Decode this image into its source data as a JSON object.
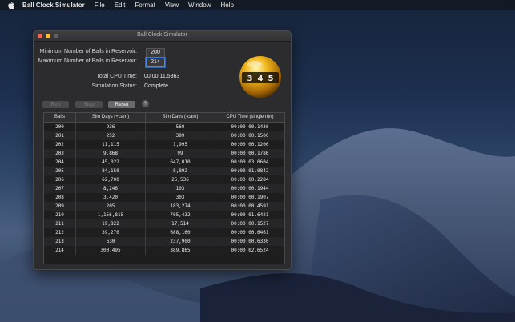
{
  "menubar": {
    "app_name": "Ball Clock Simulator",
    "items": [
      "File",
      "Edit",
      "Format",
      "View",
      "Window",
      "Help"
    ]
  },
  "window": {
    "title": "Ball Clock Simulator"
  },
  "settings": {
    "min_label": "Minimum Number of Balls in Reservoir:",
    "min_value": "200",
    "max_label": "Maximum Number of Balls in Reservoir:",
    "max_value": "214",
    "cpu_label": "Total CPU Time:",
    "cpu_value": "00:00:11.5363",
    "status_label": "Simulation Status:",
    "status_value": "Complete"
  },
  "buttons": {
    "run": "Run",
    "stop": "Stop",
    "reset": "Reset",
    "help": "?"
  },
  "logo": {
    "digits": [
      "3",
      "4",
      "5"
    ]
  },
  "table": {
    "columns": [
      "Balls",
      "Sim Days (+cam)",
      "Sim Days (-cam)",
      "CPU Time (single run)"
    ],
    "rows": [
      [
        "200",
        "936",
        "560",
        "00:00:00.1436"
      ],
      [
        "201",
        "252",
        "399",
        "00:00:00.1500"
      ],
      [
        "202",
        "11,115",
        "1,995",
        "00:00:00.1206"
      ],
      [
        "203",
        "9,868",
        "99",
        "00:00:00.1786"
      ],
      [
        "204",
        "45,022",
        "647,010",
        "00:00:03.0604"
      ],
      [
        "205",
        "84,150",
        "8,892",
        "00:00:01.0842"
      ],
      [
        "206",
        "62,700",
        "25,536",
        "00:00:00.2284"
      ],
      [
        "207",
        "8,246",
        "103",
        "00:00:00.1944"
      ],
      [
        "208",
        "3,420",
        "303",
        "00:00:00.1907"
      ],
      [
        "209",
        "205",
        "183,274",
        "00:00:00.4591"
      ],
      [
        "210",
        "1,156,815",
        "705,432",
        "00:00:01.6421"
      ],
      [
        "211",
        "19,822",
        "17,514",
        "00:00:00.1527"
      ],
      [
        "212",
        "39,270",
        "688,160",
        "00:00:00.6461"
      ],
      [
        "213",
        "630",
        "237,900",
        "00:00:00.6330"
      ],
      [
        "214",
        "300,495",
        "389,865",
        "00:00:02.6524"
      ]
    ]
  },
  "colors": {
    "accent": "#3b8cff",
    "close": "#ff5f57",
    "minimize": "#febc2e"
  }
}
